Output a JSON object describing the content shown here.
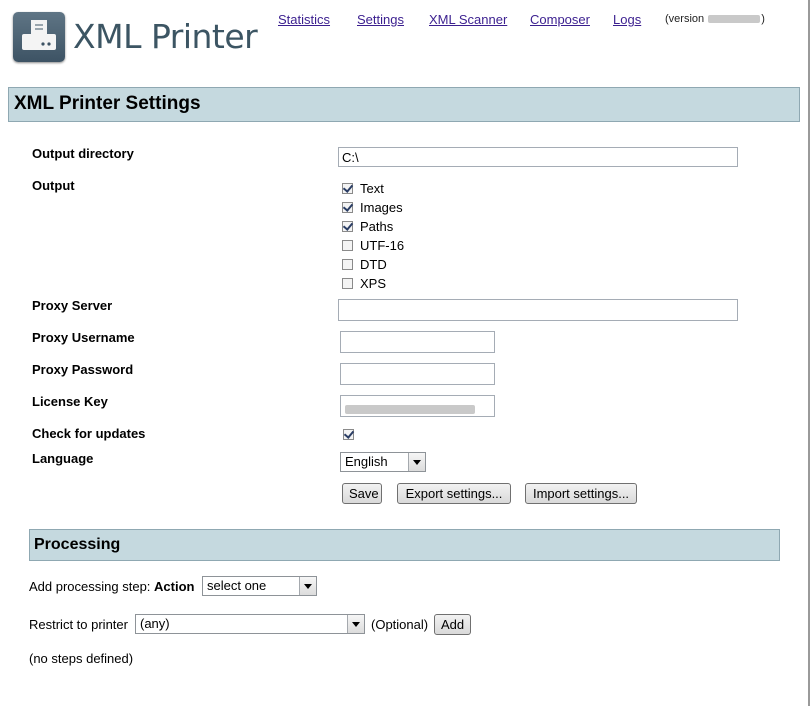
{
  "app": {
    "title": "XML Printer",
    "version_prefix": "(version",
    "version_suffix": ")"
  },
  "nav": {
    "statistics": "Statistics",
    "settings": "Settings",
    "xml_scanner": "XML Scanner",
    "composer": "Composer",
    "logs": "Logs"
  },
  "settings": {
    "heading": "XML Printer Settings",
    "output_directory": {
      "label": "Output directory",
      "value": "C:\\"
    },
    "output": {
      "label": "Output",
      "options": [
        {
          "label": "Text",
          "checked": true
        },
        {
          "label": "Images",
          "checked": true
        },
        {
          "label": "Paths",
          "checked": true
        },
        {
          "label": "UTF-16",
          "checked": false
        },
        {
          "label": "DTD",
          "checked": false
        },
        {
          "label": "XPS",
          "checked": false
        }
      ]
    },
    "proxy_server": {
      "label": "Proxy Server",
      "value": ""
    },
    "proxy_username": {
      "label": "Proxy Username",
      "value": ""
    },
    "proxy_password": {
      "label": "Proxy Password",
      "value": ""
    },
    "license_key": {
      "label": "License Key"
    },
    "check_updates": {
      "label": "Check for updates",
      "checked": true
    },
    "language": {
      "label": "Language",
      "value": "English"
    },
    "buttons": {
      "save": "Save",
      "export": "Export settings...",
      "import": "Import settings..."
    }
  },
  "processing": {
    "heading": "Processing",
    "add_step_label": "Add processing step:",
    "action_label": "Action",
    "action_value": "select one",
    "restrict_label": "Restrict to printer",
    "printer_value": "(any)",
    "optional": "(Optional)",
    "add_button": "Add",
    "no_steps": "(no steps defined)"
  },
  "colors": {
    "section_bar": "#c5d9df",
    "link": "#3b1f8f",
    "brand": "#3c5563"
  }
}
